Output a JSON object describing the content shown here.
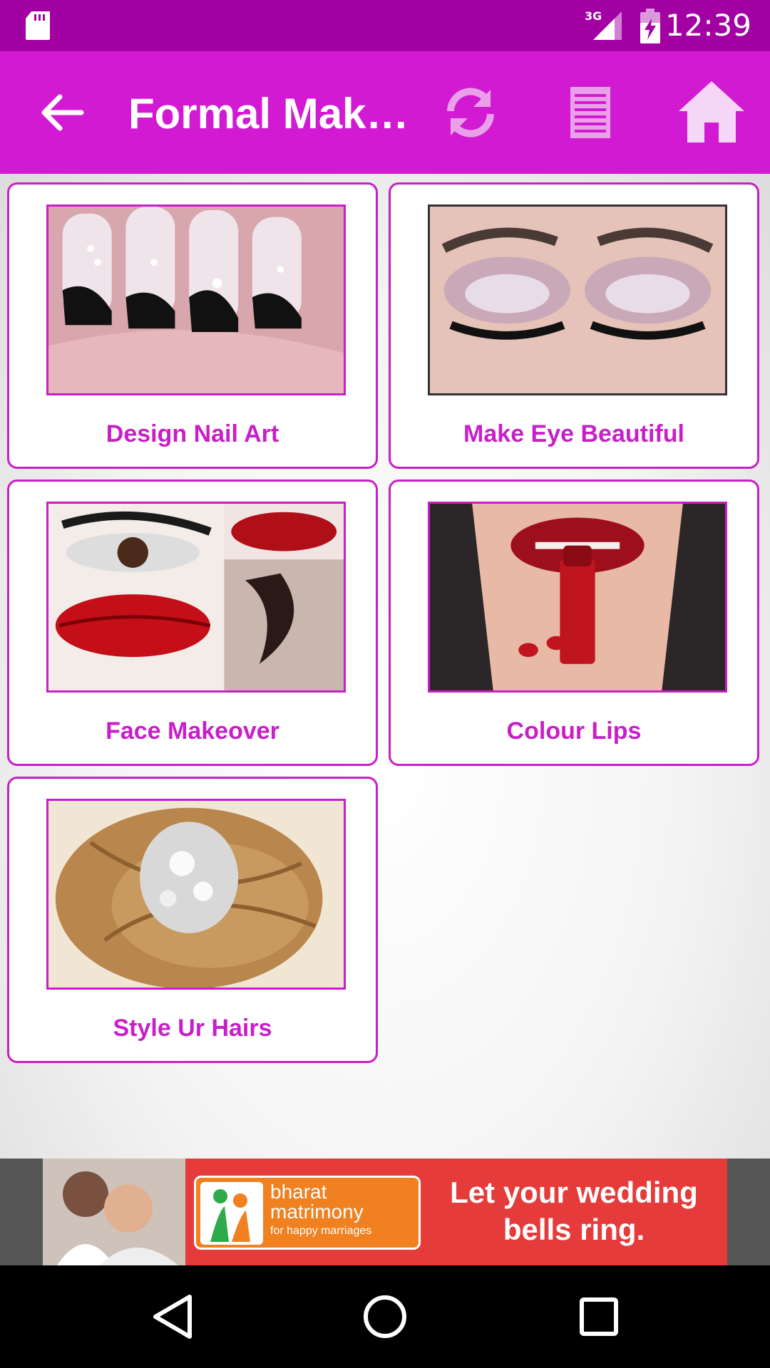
{
  "status_bar": {
    "time": "12:39",
    "network": "3G",
    "icons": [
      "sd-card-icon",
      "signal-icon",
      "battery-charging-icon"
    ]
  },
  "app_bar": {
    "title": "Formal Mak…",
    "icons": [
      "back-arrow-icon",
      "refresh-icon",
      "list-icon",
      "home-icon"
    ]
  },
  "cards": [
    {
      "label": "Design Nail Art",
      "image": "nail-art-image"
    },
    {
      "label": "Make Eye Beautiful",
      "image": "eye-makeup-image"
    },
    {
      "label": "Face Makeover",
      "image": "face-makeover-image"
    },
    {
      "label": "Colour Lips",
      "image": "lipstick-image"
    },
    {
      "label": "Style Ur Hairs",
      "image": "hair-style-image"
    }
  ],
  "ad": {
    "brand_line1": "bharat",
    "brand_line2": "matrimony",
    "brand_tag": "for happy marriages",
    "slogan_line1": "Let your wedding",
    "slogan_line2": "bells ring."
  },
  "nav_bar": {
    "icons": [
      "back-triangle-icon",
      "home-circle-icon",
      "recents-square-icon"
    ]
  },
  "colors": {
    "status_bar": "#a300a3",
    "app_bar": "#d21ad2",
    "accent": "#c81fc8",
    "ad_background": "#e63b3b"
  }
}
